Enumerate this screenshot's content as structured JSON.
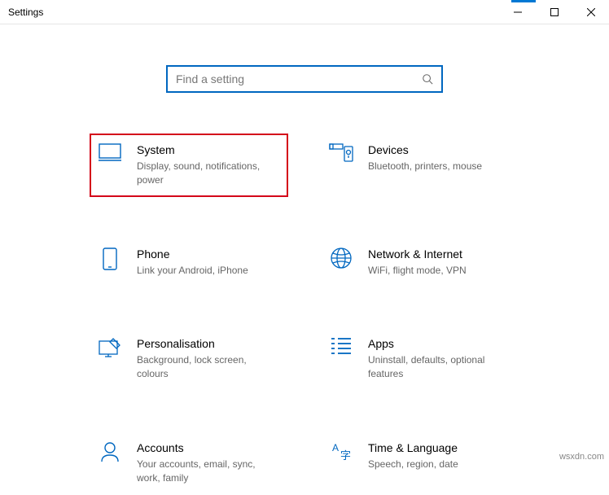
{
  "window": {
    "title": "Settings"
  },
  "search": {
    "placeholder": "Find a setting"
  },
  "tiles": {
    "system": {
      "title": "System",
      "desc": "Display, sound, notifications, power"
    },
    "devices": {
      "title": "Devices",
      "desc": "Bluetooth, printers, mouse"
    },
    "phone": {
      "title": "Phone",
      "desc": "Link your Android, iPhone"
    },
    "network": {
      "title": "Network & Internet",
      "desc": "WiFi, flight mode, VPN"
    },
    "personalisation": {
      "title": "Personalisation",
      "desc": "Background, lock screen, colours"
    },
    "apps": {
      "title": "Apps",
      "desc": "Uninstall, defaults, optional features"
    },
    "accounts": {
      "title": "Accounts",
      "desc": "Your accounts, email, sync, work, family"
    },
    "time": {
      "title": "Time & Language",
      "desc": "Speech, region, date"
    }
  },
  "watermark": "wsxdn.com"
}
